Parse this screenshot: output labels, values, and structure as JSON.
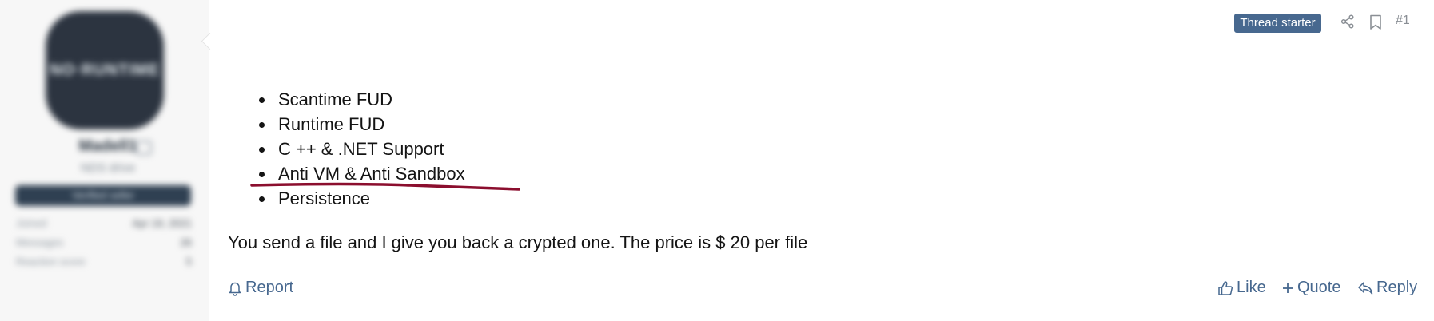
{
  "header": {
    "badge": "Thread starter",
    "post_number": "#1",
    "icons": [
      "share-icon",
      "bookmark-icon"
    ]
  },
  "sidebar": {
    "avatar_text": "NO·RUNTIME",
    "username": "Madell1",
    "title": "NDS drive",
    "banner": "Verified seller",
    "stats": [
      {
        "label": "Joined",
        "value": "Apr 19, 2021"
      },
      {
        "label": "Messages",
        "value": "26"
      },
      {
        "label": "Reaction score",
        "value": "5"
      }
    ]
  },
  "post": {
    "features": [
      "Scantime FUD",
      "Runtime FUD",
      "C ++ & .NET Support",
      "Anti VM & Anti Sandbox",
      "Persistence"
    ],
    "body": "You send a file and I give you back a crypted one. The price is $ 20 per file"
  },
  "footer": {
    "report": "Report",
    "like": "Like",
    "quote": "Quote",
    "reply": "Reply"
  },
  "colors": {
    "accent": "#47688f",
    "underline": "#8b0e2e",
    "sidebar_bg": "#f7f7f7"
  }
}
